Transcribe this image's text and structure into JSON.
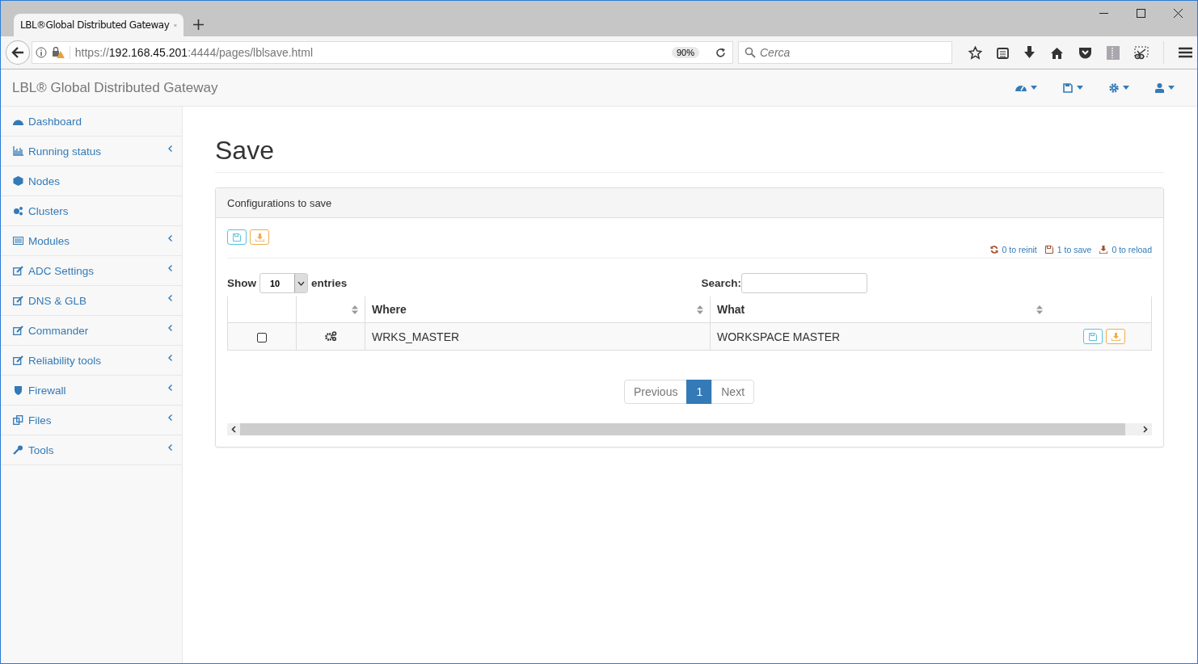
{
  "browser": {
    "tab_title": "LBL®Global Distributed Gateway",
    "url": {
      "scheme": "https://",
      "host": "192.168.45.201",
      "rest": ":4444/pages/lblsave.html"
    },
    "zoom": "90%",
    "search": {
      "placeholder": "Cerca"
    }
  },
  "app": {
    "brand": "LBL® Global Distributed Gateway"
  },
  "sidebar": {
    "items": [
      {
        "label": "Dashboard",
        "has_submenu": false
      },
      {
        "label": "Running status",
        "has_submenu": true
      },
      {
        "label": "Nodes",
        "has_submenu": false
      },
      {
        "label": "Clusters",
        "has_submenu": false
      },
      {
        "label": "Modules",
        "has_submenu": true
      },
      {
        "label": "ADC Settings",
        "has_submenu": true
      },
      {
        "label": "DNS & GLB",
        "has_submenu": true
      },
      {
        "label": "Commander",
        "has_submenu": true
      },
      {
        "label": "Reliability tools",
        "has_submenu": true
      },
      {
        "label": "Firewall",
        "has_submenu": true
      },
      {
        "label": "Files",
        "has_submenu": true
      },
      {
        "label": "Tools",
        "has_submenu": true
      }
    ]
  },
  "page": {
    "title": "Save",
    "panel": {
      "heading": "Configurations to save",
      "counters": [
        {
          "kind": "reinit",
          "text": "0 to reinit"
        },
        {
          "kind": "save",
          "text": "1 to save"
        },
        {
          "kind": "reload",
          "text": "0 to reload"
        }
      ],
      "length": {
        "before": "Show",
        "value": "10",
        "after": "entries"
      },
      "search_label": "Search:",
      "table": {
        "columns": [
          {
            "sortable": false
          },
          {
            "sortable": true
          },
          {
            "label": "Where",
            "sortable": true
          },
          {
            "label": "What",
            "sortable": true
          },
          {
            "sortable": false
          }
        ],
        "rows": [
          {
            "checked": false,
            "where": "WRKS_MASTER",
            "what": "WORKSPACE MASTER"
          }
        ]
      },
      "pagination": [
        {
          "label": "Previous",
          "selected": false
        },
        {
          "label": "1",
          "selected": true
        },
        {
          "label": "Next",
          "selected": false
        }
      ]
    }
  }
}
